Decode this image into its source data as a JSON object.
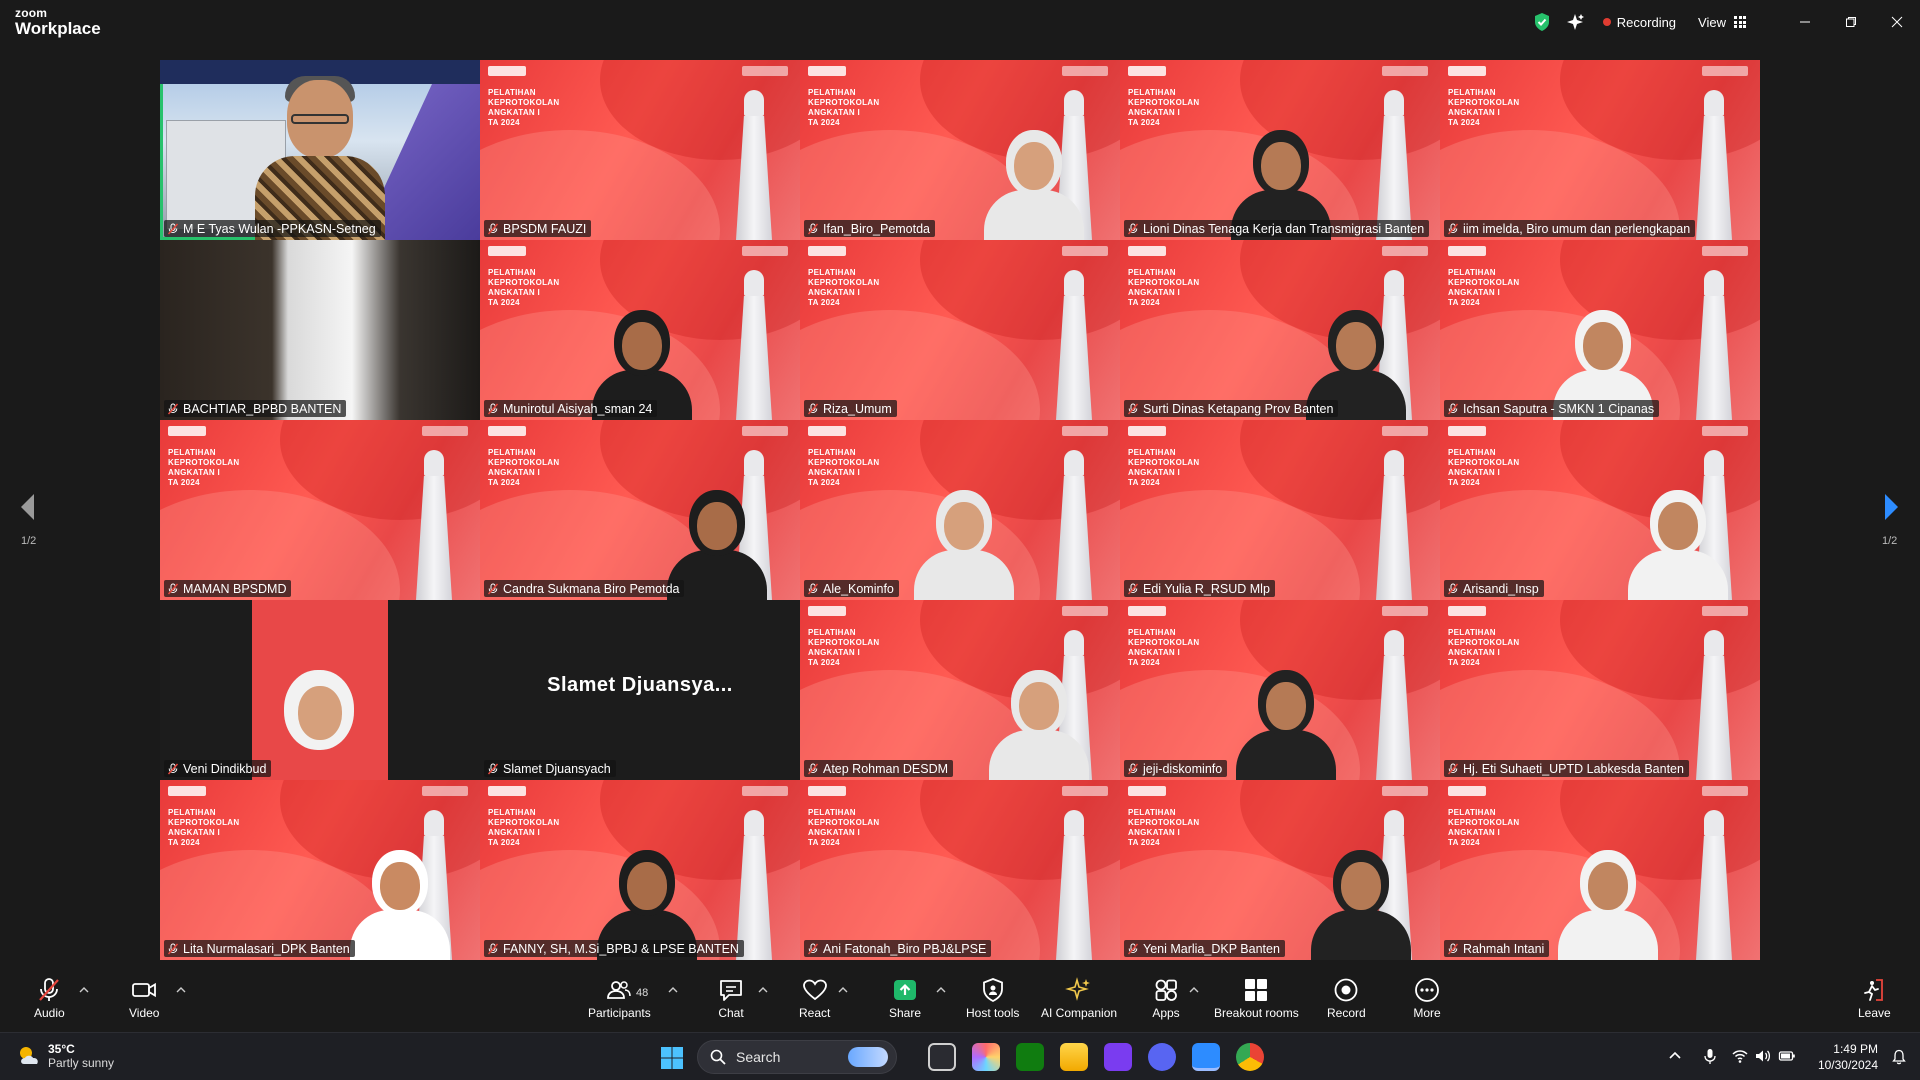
{
  "app": {
    "logo_line1": "zoom",
    "logo_line2": "Workplace"
  },
  "titlebar": {
    "recording_label": "Recording",
    "view_label": "View"
  },
  "tiles": [
    {
      "name": "M E  Tyas Wulan -PPKASN-Setneg",
      "kind": "speaker",
      "active": true
    },
    {
      "name": "BPSDM FAUZI",
      "kind": "slide"
    },
    {
      "name": "Ifan_Biro_Pemotda",
      "kind": "slide"
    },
    {
      "name": "Lioni Dinas Tenaga Kerja dan Transmigrasi Banten",
      "kind": "slide"
    },
    {
      "name": "iim imelda, Biro umum dan perlengkapan",
      "kind": "slide"
    },
    {
      "name": "BACHTIAR_BPBD BANTEN",
      "kind": "dark"
    },
    {
      "name": "Munirotul Aisiyah_sman 24",
      "kind": "slide"
    },
    {
      "name": "Riza_Umum",
      "kind": "slide"
    },
    {
      "name": "Surti Dinas Ketapang Prov Banten",
      "kind": "slide"
    },
    {
      "name": "Ichsan Saputra - SMKN 1 Cipanas",
      "kind": "slide"
    },
    {
      "name": "MAMAN BPSDMD",
      "kind": "slide"
    },
    {
      "name": "Candra Sukmana Biro Pemotda",
      "kind": "slide"
    },
    {
      "name": "Ale_Kominfo",
      "kind": "slide"
    },
    {
      "name": "Edi Yulia R_RSUD Mlp",
      "kind": "slide"
    },
    {
      "name": "Arisandi_Insp",
      "kind": "slide"
    },
    {
      "name": "Veni Dindikbud",
      "kind": "dark"
    },
    {
      "name": "Slamet Djuansyach",
      "kind": "dark",
      "big_label": "Slamet  Djuansya..."
    },
    {
      "name": "Atep Rohman DESDM",
      "kind": "slide"
    },
    {
      "name": "jeji-diskominfo",
      "kind": "slide"
    },
    {
      "name": "Hj. Eti Suhaeti_UPTD Labkesda Banten",
      "kind": "slide"
    },
    {
      "name": "Lita Nurmalasari_DPK Banten",
      "kind": "slide"
    },
    {
      "name": "FANNY, SH, M.Si_BPBJ & LPSE BANTEN",
      "kind": "slide"
    },
    {
      "name": "Ani Fatonah_Biro PBJ&LPSE",
      "kind": "slide"
    },
    {
      "name": "Yeni Marlia_DKP Banten",
      "kind": "slide"
    },
    {
      "name": "Rahmah Intani",
      "kind": "slide"
    }
  ],
  "slide": {
    "line1": "PELATIHAN",
    "line2": "KEPROTOKOLAN",
    "line3": "ANGKATAN I",
    "line4": "TA 2024"
  },
  "pager": {
    "left": "1/2",
    "right": "1/2"
  },
  "toolbar": {
    "audio": "Audio",
    "video": "Video",
    "participants": "Participants",
    "participants_count": "48",
    "chat": "Chat",
    "react": "React",
    "share": "Share",
    "host_tools": "Host tools",
    "ai_companion": "AI Companion",
    "apps": "Apps",
    "breakout": "Breakout rooms",
    "record": "Record",
    "more": "More",
    "leave": "Leave"
  },
  "taskbar": {
    "temp": "35°C",
    "weather": "Partly sunny",
    "search_placeholder": "Search",
    "time": "1:49 PM",
    "date": "10/30/2024"
  },
  "colors": {
    "accent_green": "#27c26c",
    "recording_red": "#e03c31",
    "share_green": "#1fb86a",
    "mute_red": "#e5453b"
  }
}
